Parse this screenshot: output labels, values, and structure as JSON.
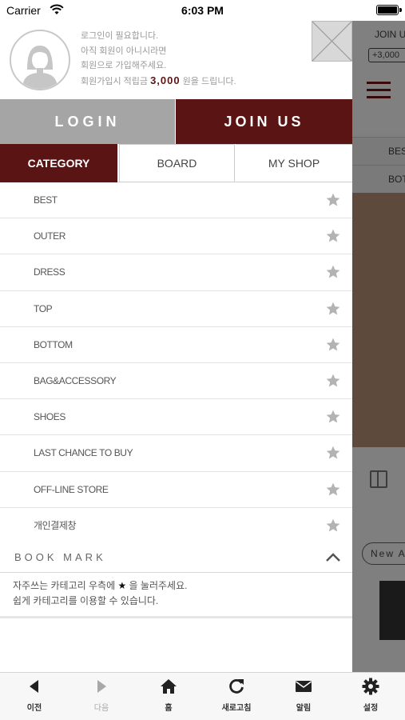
{
  "status_bar": {
    "carrier": "Carrier",
    "time": "6:03 PM",
    "battery_level": 1.0
  },
  "background_page": {
    "join_label": "JOIN U",
    "points_pill": "+3,000",
    "menu_row_1": "BES",
    "menu_row_2": "BOTT",
    "new_pill": "New A"
  },
  "profile": {
    "message_lines": [
      "로그인이 필요합니다.",
      "아직 회원이 아니시라면",
      "회원으로 가입해주세요."
    ],
    "reward_prefix": "회원가입시 적립금 ",
    "reward_amount": "3,000",
    "reward_suffix": " 원을 드립니다."
  },
  "auth": {
    "login_label": "LOGIN",
    "join_label": "JOIN US"
  },
  "tabs": [
    {
      "label": "CATEGORY",
      "active": true
    },
    {
      "label": "BOARD",
      "active": false
    },
    {
      "label": "MY SHOP",
      "active": false
    }
  ],
  "categories": [
    {
      "label": "BEST"
    },
    {
      "label": "OUTER"
    },
    {
      "label": "DRESS"
    },
    {
      "label": "TOP"
    },
    {
      "label": "BOTTOM"
    },
    {
      "label": "BAG&ACCESSORY"
    },
    {
      "label": "SHOES"
    },
    {
      "label": "LAST CHANCE TO BUY"
    },
    {
      "label": "OFF-LINE STORE"
    },
    {
      "label": "개인결제창"
    }
  ],
  "bookmark": {
    "title": "BOOK MARK",
    "note_line1_prefix": "자주쓰는 카테고리 우측에 ",
    "note_star": "★",
    "note_line1_suffix": " 을 눌러주세요.",
    "note_line2": "쉽게 카테고리를 이용할 수 있습니다."
  },
  "toolbar": [
    {
      "label": "이전",
      "icon": "back-arrow-icon",
      "enabled": true
    },
    {
      "label": "다음",
      "icon": "forward-arrow-icon",
      "enabled": false
    },
    {
      "label": "홈",
      "icon": "home-icon",
      "enabled": true
    },
    {
      "label": "새로고침",
      "icon": "refresh-icon",
      "enabled": true
    },
    {
      "label": "알림",
      "icon": "mail-icon",
      "enabled": true
    },
    {
      "label": "설정",
      "icon": "gear-icon",
      "enabled": true
    }
  ],
  "colors": {
    "brand": "#5a1414",
    "login_gray": "#a5a5a5",
    "star_gray": "#b3b3b3"
  }
}
